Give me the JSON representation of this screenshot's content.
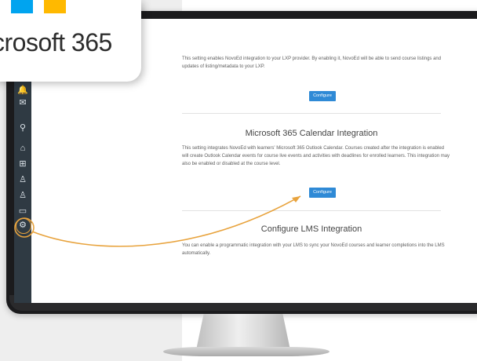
{
  "badge": {
    "text": "crosoft 365",
    "logo_colors": [
      "#00a4ef",
      "#ffb900"
    ]
  },
  "sidebar": {
    "items": [
      {
        "icon": "bell-icon",
        "glyph": "🔔"
      },
      {
        "icon": "mail-icon",
        "glyph": "✉"
      },
      {
        "icon": "search-icon",
        "glyph": "⚲"
      },
      {
        "icon": "home-icon",
        "glyph": "⌂"
      },
      {
        "icon": "plus-square-icon",
        "glyph": "⊞"
      },
      {
        "icon": "user-icon",
        "glyph": "♙"
      },
      {
        "icon": "user-list-icon",
        "glyph": "♙"
      },
      {
        "icon": "card-icon",
        "glyph": "▭"
      },
      {
        "icon": "settings-icon",
        "glyph": "⚙"
      }
    ],
    "active_color": "#e8a33d"
  },
  "sections": [
    {
      "title": "",
      "text": "This setting enables NovoEd integration to your LXP provider. By enabling it, NovoEd will be able to send course listings and updates of listing/metadata to your LXP.",
      "button": "Configure"
    },
    {
      "title": "Microsoft 365 Calendar Integration",
      "text": "This setting integrates NovoEd with learners' Microsoft 365 Outlook Calendar. Courses created after the integration is enabled will create Outlook Calendar events for course live events and activities with deadlines for enrolled learners. This integration may also be enabled or disabled at the course level.",
      "button": "Configure"
    },
    {
      "title": "Configure LMS Integration",
      "text": "You can enable a programmatic integration with your LMS to sync your NovoEd courses and learner completions into the LMS automatically.",
      "button": ""
    }
  ],
  "colors": {
    "button": "#2f8ad6",
    "callout": "#e8a33d",
    "sidebar": "#2f3a43"
  }
}
